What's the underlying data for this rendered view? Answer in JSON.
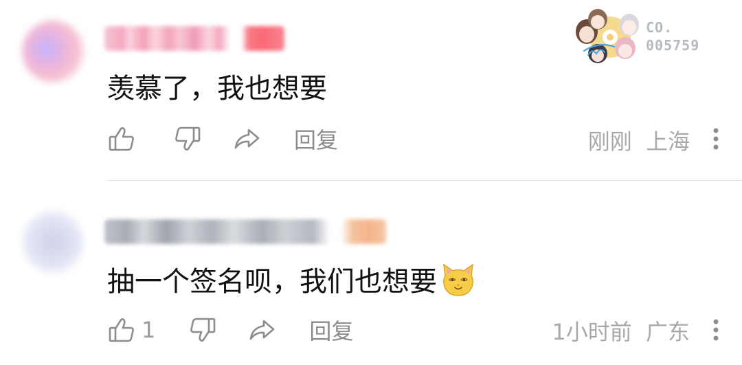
{
  "comments": [
    {
      "content": "羡慕了，我也想要",
      "like_count": "",
      "reply_label": "回复",
      "time": "刚刚",
      "location": "上海"
    },
    {
      "content": "抽一个签名呗，我们也想要",
      "like_count": "1",
      "reply_label": "回复",
      "time": "1小时前",
      "location": "广东"
    }
  ],
  "watermark": {
    "line1": "CO.",
    "line2": "005759"
  },
  "colors": {
    "text": "#111111",
    "muted": "#a9a9a9",
    "icon": "#8c8c8c",
    "divider": "#e3e3e3"
  }
}
